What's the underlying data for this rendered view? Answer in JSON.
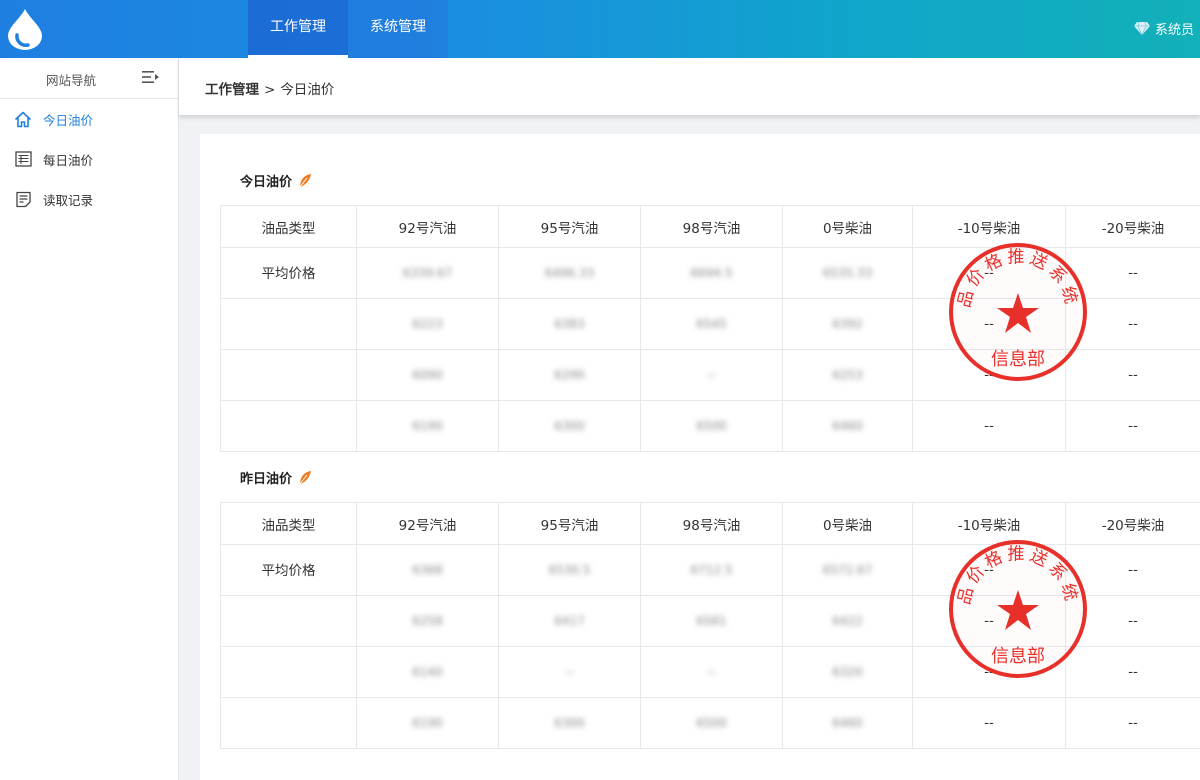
{
  "app": {
    "name_line1": "",
    "name_line2": ""
  },
  "top_nav": [
    {
      "label": "工作管理",
      "active": true
    },
    {
      "label": "系统管理",
      "active": false
    }
  ],
  "user": {
    "name": "系统员",
    "icon": "diamond-icon"
  },
  "sidebar": {
    "title": "网站导航",
    "toggle_icon": "menu-collapse-icon",
    "items": [
      {
        "label": "今日油价",
        "icon": "home-icon",
        "active": true
      },
      {
        "label": "每日油价",
        "icon": "list-icon",
        "active": false
      },
      {
        "label": "读取记录",
        "icon": "record-icon",
        "active": false
      }
    ]
  },
  "breadcrumb": {
    "parent": "工作管理",
    "separator": ">",
    "current": "今日油价"
  },
  "columns": [
    "油品类型",
    "92号汽油",
    "95号汽油",
    "98号汽油",
    "0号柴油",
    "-10号柴油",
    "-20号柴油"
  ],
  "today": {
    "title": "今日油价",
    "rows": [
      {
        "label": "平均价格",
        "values": [
          "6339.67",
          "6496.33",
          "6694.5",
          "6535.33",
          "--",
          "--"
        ]
      },
      {
        "label": "",
        "values": [
          "6223",
          "6383",
          "6545",
          "6392",
          "--",
          "--"
        ]
      },
      {
        "label": "",
        "values": [
          "6090",
          "6290",
          "--",
          "6253",
          "--",
          "--"
        ]
      },
      {
        "label": "",
        "values": [
          "6190",
          "6300",
          "6500",
          "6460",
          "--",
          "--"
        ]
      }
    ]
  },
  "yesterday": {
    "title": "昨日油价",
    "rows": [
      {
        "label": "平均价格",
        "values": [
          "6368",
          "6530.5",
          "6712.5",
          "6572.67",
          "--",
          "--"
        ]
      },
      {
        "label": "",
        "values": [
          "6258",
          "6417",
          "6581",
          "6422",
          "--",
          "--"
        ]
      },
      {
        "label": "",
        "values": [
          "6140",
          "--",
          "--",
          "6320",
          "--",
          "--"
        ]
      },
      {
        "label": "",
        "values": [
          "6190",
          "6300",
          "6500",
          "6460",
          "--",
          "--"
        ]
      }
    ]
  },
  "stamp": {
    "top_text": "品价格推送系统",
    "bottom_text": "信息部",
    "color": "#e8302a"
  },
  "colors": {
    "accent": "#1e7fe0",
    "stamp": "#e8302a",
    "feather": "#f07c1e"
  }
}
